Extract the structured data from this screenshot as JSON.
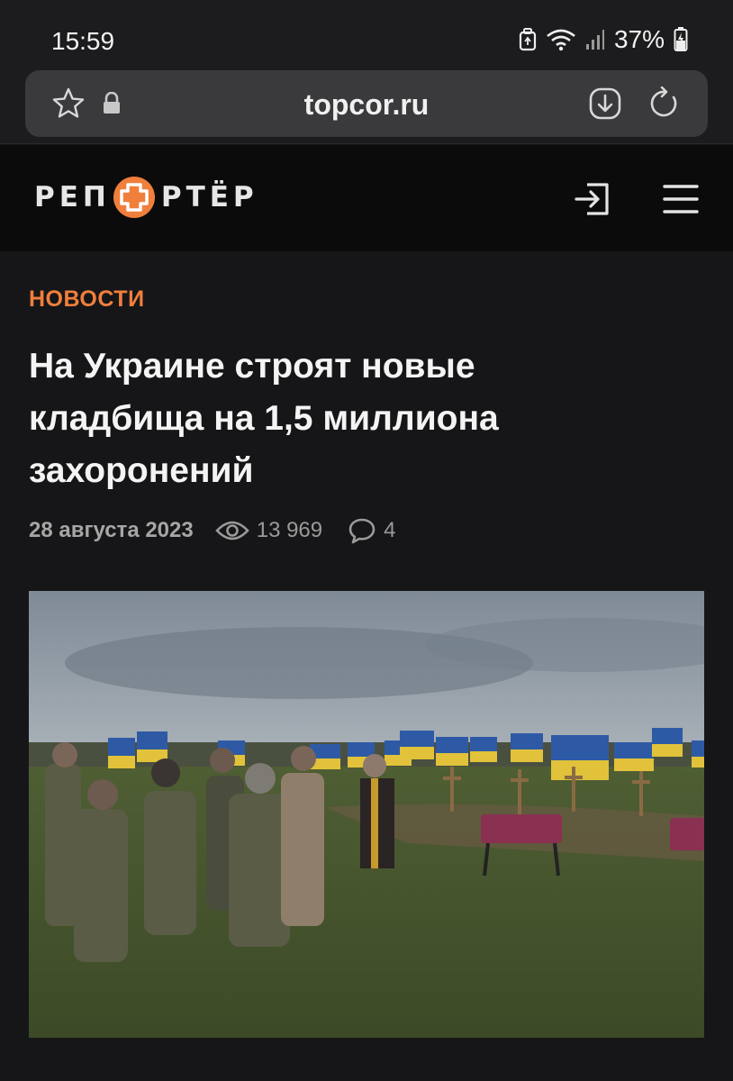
{
  "status_bar": {
    "time": "15:59",
    "battery": "37%",
    "icons": [
      "recycle-bin-icon",
      "wifi-icon",
      "signal-icon",
      "battery-icon"
    ]
  },
  "browser": {
    "url": "topcor.ru",
    "icons": [
      "star-icon",
      "lock-icon",
      "download-icon",
      "reload-icon"
    ]
  },
  "site_header": {
    "logo_left": "РЕП",
    "logo_right": "РТЁР",
    "icons": [
      "login-icon",
      "menu-icon"
    ],
    "brand_color": "#f07f3c"
  },
  "article": {
    "category": "НОВОСТИ",
    "headline_lines": [
      "На Украине строят новые",
      "кладбища на 1,5 миллиона",
      "захоронений"
    ],
    "date": "28 августа 2023",
    "views": "13 969",
    "comments": "4",
    "image_icon": "cemetery-photo"
  },
  "colors": {
    "background": "#161618",
    "accent": "#f07f3c",
    "header": "#0b0b0c"
  }
}
